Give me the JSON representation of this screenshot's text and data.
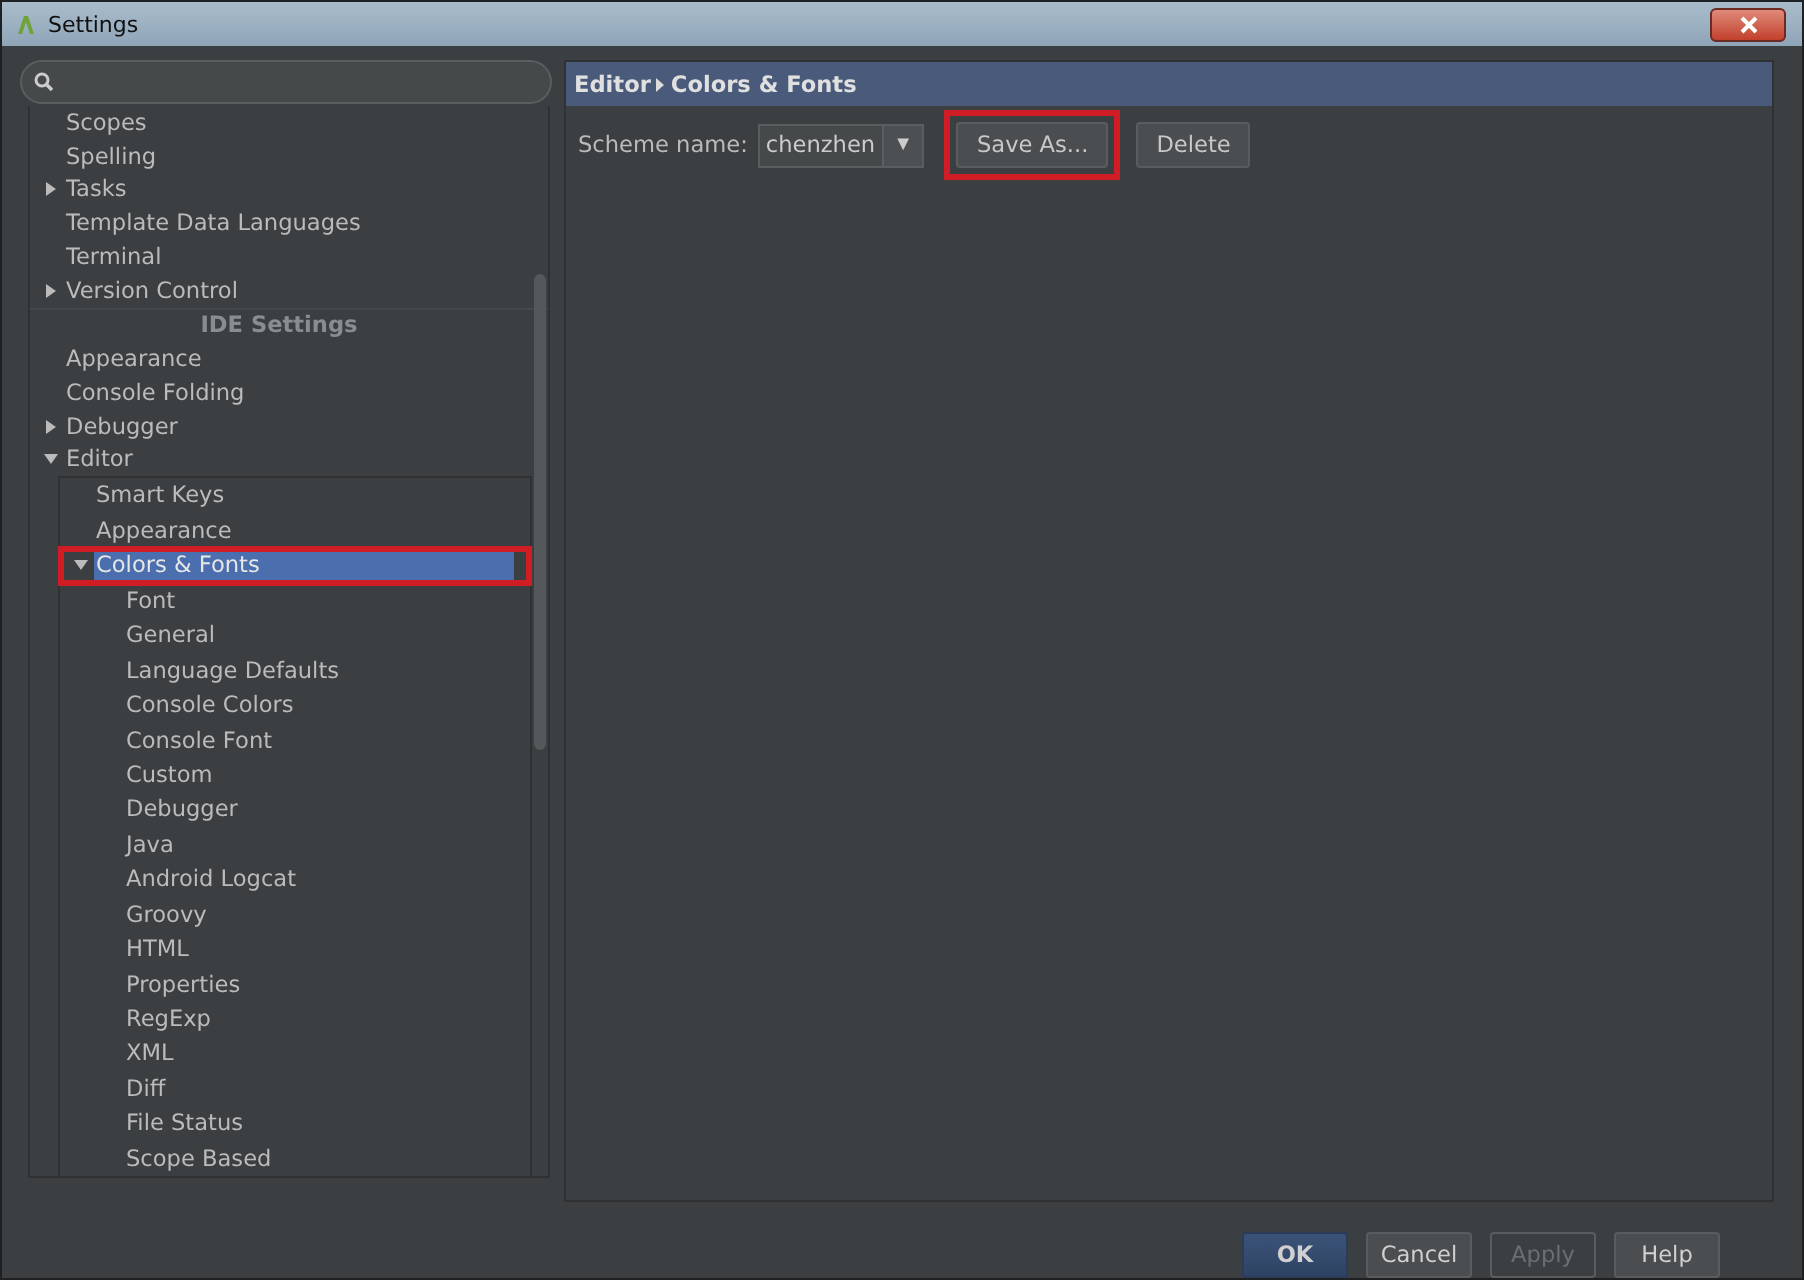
{
  "window": {
    "title": "Settings"
  },
  "tree": [
    {
      "label": "Scopes",
      "kind": "item",
      "selected": false
    },
    {
      "label": "Spelling",
      "kind": "item",
      "selected": false
    },
    {
      "label": "Tasks",
      "kind": "item",
      "selected": false,
      "expanded": false
    },
    {
      "label": "Template Data Languages",
      "kind": "item",
      "selected": false
    },
    {
      "label": "Terminal",
      "kind": "item",
      "selected": false
    },
    {
      "label": "Version Control",
      "kind": "item",
      "selected": false,
      "expanded": false
    },
    {
      "label": "IDE Settings",
      "kind": "header"
    },
    {
      "label": "Appearance",
      "kind": "item",
      "selected": false
    },
    {
      "label": "Console Folding",
      "kind": "item",
      "selected": false
    },
    {
      "label": "Debugger",
      "kind": "item",
      "selected": false,
      "expanded": false
    },
    {
      "label": "Editor",
      "kind": "item",
      "selected": false,
      "expanded": true,
      "children": [
        {
          "label": "Smart Keys",
          "kind": "item",
          "selected": false
        },
        {
          "label": "Appearance",
          "kind": "item",
          "selected": false
        },
        {
          "label": "Colors & Fonts",
          "kind": "item",
          "selected": true,
          "expanded": true,
          "highlighted": true,
          "children": [
            {
              "label": "Font",
              "kind": "item",
              "selected": false
            },
            {
              "label": "General",
              "kind": "item",
              "selected": false
            },
            {
              "label": "Language Defaults",
              "kind": "item",
              "selected": false
            },
            {
              "label": "Console Colors",
              "kind": "item",
              "selected": false
            },
            {
              "label": "Console Font",
              "kind": "item",
              "selected": false
            },
            {
              "label": "Custom",
              "kind": "item",
              "selected": false
            },
            {
              "label": "Debugger",
              "kind": "item",
              "selected": false
            },
            {
              "label": "Java",
              "kind": "item",
              "selected": false
            },
            {
              "label": "Android Logcat",
              "kind": "item",
              "selected": false
            },
            {
              "label": "Groovy",
              "kind": "item",
              "selected": false
            },
            {
              "label": "HTML",
              "kind": "item",
              "selected": false
            },
            {
              "label": "Properties",
              "kind": "item",
              "selected": false
            },
            {
              "label": "RegExp",
              "kind": "item",
              "selected": false
            },
            {
              "label": "XML",
              "kind": "item",
              "selected": false
            },
            {
              "label": "Diff",
              "kind": "item",
              "selected": false
            },
            {
              "label": "File Status",
              "kind": "item",
              "selected": false
            },
            {
              "label": "Scope Based",
              "kind": "item",
              "selected": false
            }
          ]
        }
      ]
    }
  ],
  "breadcrumb": [
    "Editor",
    "Colors & Fonts"
  ],
  "scheme": {
    "label": "Scheme name:",
    "value": "chenzhen",
    "dropdown_glyph": "▼"
  },
  "scheme_buttons": [
    {
      "label": "Save As...",
      "highlighted": true
    },
    {
      "label": "Delete",
      "highlighted": false
    }
  ],
  "footer_buttons": [
    {
      "label": "OK",
      "kind": "default",
      "disabled": false
    },
    {
      "label": "Cancel",
      "kind": "normal",
      "disabled": false
    },
    {
      "label": "Apply",
      "kind": "normal",
      "disabled": true
    },
    {
      "label": "Help",
      "kind": "normal",
      "disabled": false
    }
  ]
}
